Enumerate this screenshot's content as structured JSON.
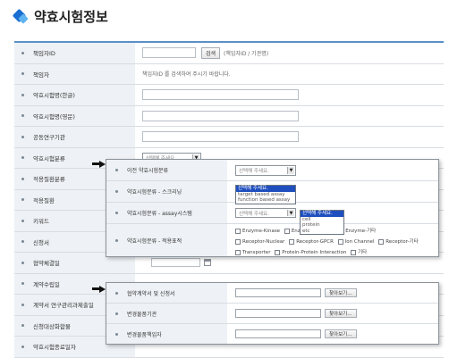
{
  "page": {
    "title": "약효시험정보"
  },
  "main_rows": [
    {
      "label": "책임자ID"
    },
    {
      "label": "책임자"
    },
    {
      "label": "약효시험명(한글)"
    },
    {
      "label": "약효시험명(영문)"
    },
    {
      "label": "공동연구기관"
    },
    {
      "label": "약효시험분류"
    },
    {
      "label": "적용질환분류"
    },
    {
      "label": "적용질환"
    },
    {
      "label": "키워드"
    },
    {
      "label": "신청서"
    },
    {
      "label": "협약체결일"
    },
    {
      "label": "계약수립일"
    },
    {
      "label": "계약서 연구관리과제출일"
    },
    {
      "label": "신청대상화합물"
    },
    {
      "label": "약효시험종료일자"
    }
  ],
  "responsible_id": {
    "search_button": "검색",
    "hint": "(책임자ID / 기관명)"
  },
  "responsible": {
    "message": "책임자ID 를 검색하여 주시기 바랍니다."
  },
  "select_placeholder": "선택해 주세요.",
  "overlay_classification": {
    "rows": [
      {
        "label": "이전 약효시험분류",
        "select": "선택해 주세요."
      },
      {
        "label": "약효시험분류 - 스크리닝"
      },
      {
        "label": "약효시험분류 - assay시스템",
        "select": "선택해 주세요."
      },
      {
        "label": "약효시험분류 - 적용표적"
      }
    ],
    "screening_options": [
      "선택해 주세요.",
      "target based assay",
      "function based assay"
    ],
    "assay_options": [
      "선택해 주세요.",
      "cell",
      "protein",
      "etc"
    ],
    "targets": [
      [
        "Enzyme-Kinase",
        "Enzyme-Protease",
        "Enzyme-기타"
      ],
      [
        "Receptor-Nuclear",
        "Receptor-GPCR",
        "Ion Channel",
        "Receptor-기타"
      ],
      [
        "Transporter",
        "Protein-Protein Interaction",
        "기타"
      ]
    ]
  },
  "overlay_files": {
    "browse_label": "찾아보기...",
    "rows": [
      {
        "label": "협약계약서 및 신청서"
      },
      {
        "label": "변경물품기관"
      },
      {
        "label": "변경물품책임자"
      }
    ]
  },
  "colors": {
    "accent": "#1a6fd0",
    "label_bg": "#eef1f5",
    "highlight": "#1f4fbf"
  }
}
